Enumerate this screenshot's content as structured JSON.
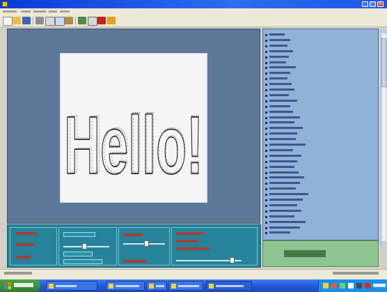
{
  "window": {
    "title": "",
    "controls": {
      "minimize": "_",
      "maximize": "□",
      "close": "x"
    }
  },
  "menu": {
    "items": [
      "",
      "",
      "",
      "",
      ""
    ]
  },
  "toolbar": {
    "buttons": [
      "new",
      "open",
      "save",
      "print",
      "cut",
      "copy",
      "paste",
      "undo",
      "zoom",
      "color",
      "record",
      "stop"
    ],
    "text": ""
  },
  "viewport": {
    "label": "",
    "canvas": {
      "text": "Hello!"
    }
  },
  "list": {
    "items": [
      "",
      "",
      "",
      "",
      "",
      "",
      "",
      "",
      "",
      "",
      "",
      "",
      "",
      "",
      "",
      "",
      "",
      "",
      "",
      "",
      "",
      "",
      "",
      "",
      "",
      "",
      "",
      "",
      "",
      "",
      "",
      "",
      "",
      "",
      "",
      "",
      ""
    ]
  },
  "green_panel": {
    "status": ""
  },
  "controls": {
    "panel1": {
      "labels": [
        "",
        "",
        ""
      ]
    },
    "panel2": {
      "fields": [
        "",
        "",
        ""
      ],
      "slider_position": 0.45
    },
    "panel3": {
      "slider_position": 0.55
    },
    "panel4": {
      "slider_position": 0.85
    }
  },
  "statusbar": {
    "left": "",
    "right": ""
  },
  "taskbar": {
    "start": "",
    "tasks": [
      "",
      "",
      "",
      "",
      ""
    ],
    "clock": ""
  },
  "colors": {
    "titlebar": "#1e56e4",
    "viewport_bg": "#5e7899",
    "list_bg": "#8fb2d7",
    "controls_bg": "#26839a",
    "green_panel": "#8dc48f",
    "accent_red": "#c8201c"
  }
}
